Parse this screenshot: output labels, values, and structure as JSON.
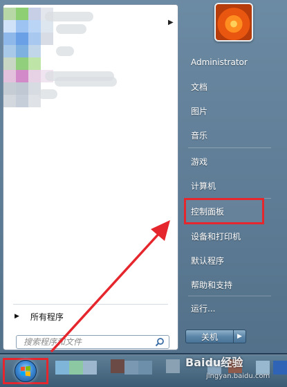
{
  "left_pane": {
    "all_programs_label": "所有程序",
    "search_placeholder": "搜索程序和文件"
  },
  "right_pane": {
    "user_name": "Administrator",
    "items": [
      {
        "label": "文档"
      },
      {
        "label": "图片"
      },
      {
        "label": "音乐"
      },
      {
        "label": "游戏"
      },
      {
        "label": "计算机"
      },
      {
        "label": "控制面板",
        "highlighted": true
      },
      {
        "label": "设备和打印机"
      },
      {
        "label": "默认程序"
      },
      {
        "label": "帮助和支持"
      },
      {
        "label": "运行..."
      }
    ],
    "shutdown_label": "关机"
  },
  "annotation": {
    "highlight_color": "#e5262d",
    "arrow_color": "#e5262d"
  },
  "watermark": {
    "logo_text": "Baidu经验",
    "url": "jingyan.baidu.com"
  },
  "icons": {
    "search": "search-icon",
    "submenu": "chevron-right-icon",
    "start_orb": "windows-logo-icon"
  }
}
